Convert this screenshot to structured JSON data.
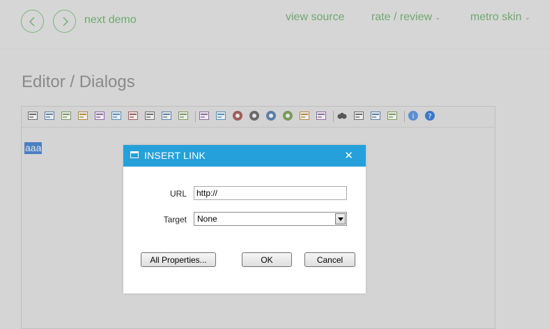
{
  "header": {
    "next_demo": "next demo",
    "view_source": "view source",
    "rate_review": "rate / review",
    "metro_skin": "metro skin"
  },
  "page": {
    "title": "Editor / Dialogs"
  },
  "editor": {
    "selected_text": "aaa",
    "toolbar_icons": [
      "form-icon",
      "html-icon",
      "table-icon",
      "link-icon",
      "image-icon",
      "image-manager-icon",
      "styles-icon",
      "w3c-validate-icon",
      "spellcheck-icon",
      "format-painter-icon",
      "sep",
      "template-icon",
      "image-map-icon",
      "flash-icon",
      "media-icon",
      "video-icon",
      "youtube-icon",
      "document-icon",
      "page-properties-icon",
      "sep",
      "find-replace-icon",
      "table-properties-icon",
      "hyperlink-manager-icon",
      "file-icon",
      "sep",
      "tooltip-icon",
      "help-icon"
    ]
  },
  "dialog": {
    "title": "INSERT LINK",
    "url_label": "URL",
    "url_value": "http://",
    "target_label": "Target",
    "target_selected": "None",
    "all_properties": "All Properties...",
    "ok": "OK",
    "cancel": "Cancel"
  },
  "colors": {
    "accent_green": "#6fa96f",
    "dialog_blue": "#25a0da",
    "selection_blue": "#4a7fc1"
  }
}
